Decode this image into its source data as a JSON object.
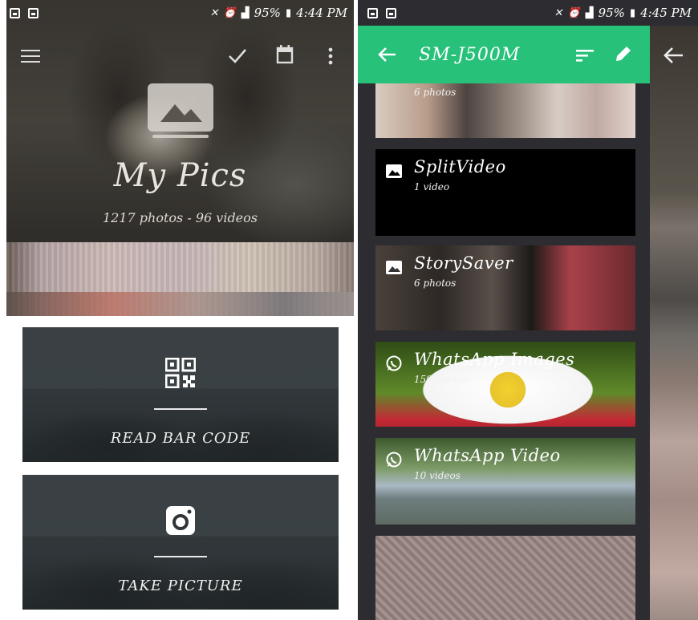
{
  "left_screen": {
    "status_bar": {
      "battery": "95%",
      "time": "4:44 PM"
    },
    "toolbar": {
      "menu_icon": "menu-icon",
      "check_icon": "check-icon",
      "calendar_icon": "calendar-icon",
      "more_icon": "more-vert-icon"
    },
    "hero": {
      "title": "My Pics",
      "subtitle": "1217 photos - 96 videos"
    },
    "actions": [
      {
        "label": "READ BAR CODE",
        "icon": "qr-code-icon"
      },
      {
        "label": "TAKE PICTURE",
        "icon": "camera-icon"
      }
    ]
  },
  "right_screen": {
    "status_bar": {
      "battery": "95%",
      "time": "4:45 PM"
    },
    "toolbar": {
      "title": "SM-J500M",
      "back_icon": "arrow-back-icon",
      "sort_icon": "sort-icon",
      "edit_icon": "edit-icon"
    },
    "albums": [
      {
        "name": "",
        "count": "6 photos",
        "icon": ""
      },
      {
        "name": "SplitVideo",
        "count": "1 video",
        "icon": "image-icon"
      },
      {
        "name": "StorySaver",
        "count": "6 photos",
        "icon": "image-icon"
      },
      {
        "name": "WhatsApp Images",
        "count": "159 photos",
        "icon": "whatsapp-icon"
      },
      {
        "name": "WhatsApp Video",
        "count": "10 videos",
        "icon": "whatsapp-icon"
      }
    ]
  },
  "colors": {
    "accent": "#27c17a",
    "dark_bg": "#2c2c31"
  }
}
